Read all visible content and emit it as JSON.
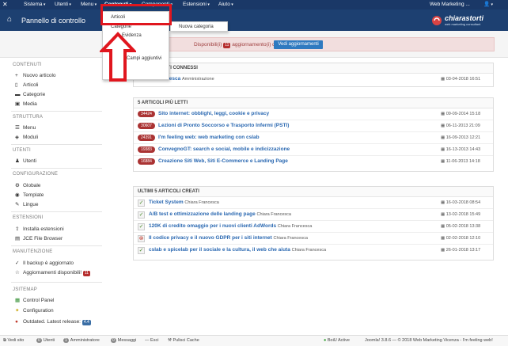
{
  "navbar": {
    "items": [
      {
        "label": "Sistema"
      },
      {
        "label": "Utenti"
      },
      {
        "label": "Menu"
      },
      {
        "label": "Contenuti"
      },
      {
        "label": "Componenti"
      },
      {
        "label": "Estensioni"
      },
      {
        "label": "Aiuto"
      }
    ],
    "site_name": "Web Marketing ...",
    "user_icon": "user-icon"
  },
  "header": {
    "title": "Pannello di controllo",
    "brand_name": "chiarastorti",
    "brand_sub": "web marketing consultant"
  },
  "alert": {
    "text": "Disponibili(i)",
    "count": "11",
    "text2": "aggiornamento(i) di estensioni.",
    "button": "Vedi aggiornamenti",
    "color": "#f2dede"
  },
  "dropdown": {
    "items": [
      "Articoli",
      "Categorie",
      "Evidenza",
      "Campi aggiuntivi"
    ],
    "submenu": "Nuova categoria"
  },
  "sidebar": {
    "sections": [
      {
        "head": "CONTENUTI",
        "items": [
          {
            "icon": "plus-icon",
            "label": "Nuovo articolo"
          },
          {
            "icon": "file-icon",
            "label": "Articoli"
          },
          {
            "icon": "folder-icon",
            "label": "Categorie"
          },
          {
            "icon": "image-icon",
            "label": "Media"
          }
        ]
      },
      {
        "head": "STRUTTURA",
        "items": [
          {
            "icon": "list-icon",
            "label": "Menu"
          },
          {
            "icon": "cube-icon",
            "label": "Moduli"
          }
        ]
      },
      {
        "head": "UTENTI",
        "items": [
          {
            "icon": "users-icon",
            "label": "Utenti"
          }
        ]
      },
      {
        "head": "CONFIGURAZIONE",
        "items": [
          {
            "icon": "gear-icon",
            "label": "Globale"
          },
          {
            "icon": "eye-icon",
            "label": "Template"
          },
          {
            "icon": "comment-icon",
            "label": "Lingue"
          }
        ]
      },
      {
        "head": "ESTENSIONI",
        "items": [
          {
            "icon": "upload-icon",
            "label": "Installa estensioni"
          },
          {
            "icon": "file-browser-icon",
            "label": "JCE File Browser"
          }
        ]
      },
      {
        "head": "MANUTENZIONE",
        "items": [
          {
            "icon": "check-icon",
            "label": "Il backup è aggiornato"
          },
          {
            "icon": "star-icon",
            "label": "Aggiornamenti disponibili!",
            "badge": "11"
          }
        ]
      },
      {
        "head": "JSITEMAP",
        "items": [
          {
            "icon": "panel-icon",
            "label": "Control Panel"
          },
          {
            "icon": "wrench-icon",
            "label": "Configuration"
          },
          {
            "icon": "error-icon",
            "label": "Outdated. Latest release:",
            "badge": "4.4"
          }
        ]
      }
    ]
  },
  "panel_users": {
    "title": "ULTIMI UTENTI CONNESSI",
    "rows": [
      {
        "name": "Chiara Francesca",
        "role": "Amministrazione",
        "date": "03-04-2018 16:51"
      }
    ]
  },
  "panel_popular": {
    "title": "5 ARTICOLI PIÙ LETTI",
    "rows": [
      {
        "count": "34424",
        "title": "Sito internet: obblighi, leggi, cookie e privacy",
        "date": "09-09-2014 15:18"
      },
      {
        "count": "30607",
        "title": "Lezioni di Pronto Soccorso e Trasporto Infermi (PSTI)",
        "date": "06-11-2013 21:09"
      },
      {
        "count": "24391",
        "title": "I'm feeling web: web marketing con cslab",
        "date": "16-09-2013 12:21"
      },
      {
        "count": "19383",
        "title": "ConvegnoGT: search e social, mobile e indicizzazione",
        "date": "16-13-2013 14:43"
      },
      {
        "count": "16884",
        "title": "Creazione Siti Web, Siti E-Commerce e Landing Page",
        "date": "11-06-2013 14:18"
      }
    ]
  },
  "panel_latest": {
    "title": "ULTIMI 5 ARTICOLI CREATI",
    "rows": [
      {
        "status": "published",
        "title": "Ticket System",
        "author": "Chiara Francesca",
        "date": "16-03-2018 08:54"
      },
      {
        "status": "published",
        "title": "A/B test e ottimizzazione delle landing page",
        "author": "Chiara Francesca",
        "date": "13-02-2018 15:49"
      },
      {
        "status": "published",
        "title": "120K di credito omaggio per i nuovi clienti AdWords",
        "author": "Chiara Francesca",
        "date": "05-02-2018 13:38"
      },
      {
        "status": "unpublished",
        "title": "Il codice privacy e il nuovo GDPR per i siti internet",
        "author": "Chiara Francesca",
        "date": "02-02-2018 12:10"
      },
      {
        "status": "published",
        "title": "cslab e spicelab per il sociale e la cultura, il web che aiuta",
        "author": "Chiara Francesca",
        "date": "26-01-2018 13:17"
      }
    ]
  },
  "footer": {
    "view_site": "Vedi sito",
    "visitors_count": "0",
    "visitors": "Utenti",
    "admins_count": "1",
    "admins": "Amministratore",
    "messages_count": "0",
    "messages": "Messaggi",
    "logout": "Esci",
    "cache": "Pulisci Cache",
    "boi": "BoiU Active",
    "copyright": "Joomla! 3.8.6 — © 2018 Web Marketing Vicenza - I'm feeling web!"
  },
  "colors": {
    "navbar": "#1a3867",
    "header": "#1d4071",
    "link": "#2a68b1",
    "highlight": "#e0161e"
  }
}
